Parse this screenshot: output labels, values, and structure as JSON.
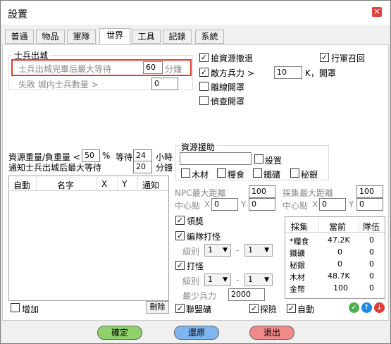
{
  "title": "設置",
  "tabs": [
    "普通",
    "物品",
    "軍隊",
    "世界",
    "工具",
    "記錄",
    "系統"
  ],
  "soldiers": {
    "group_title": "士兵出城",
    "wait_label": "士兵出城完畢后最大等待",
    "wait_value": "60",
    "wait_unit": "分鐘",
    "fail_label": "失敗 城内士兵數量 >",
    "fail_value": "0"
  },
  "right_top": {
    "grab_resource": "搶資源撤退",
    "march_recall": "行軍召回",
    "enemy_label": "敵方兵力 >",
    "enemy_value": "10",
    "enemy_unit": "K，開罩",
    "leave_shield": "離線開罩",
    "scout_shield": "偵查開罩"
  },
  "resource_weight": {
    "label": "資源重量/負重量 <",
    "value": "50",
    "percent": "%",
    "wait_label": "等待",
    "wait_value": "24",
    "wait_unit": "小時",
    "notify_label": "通知士兵出城后最大等待",
    "notify_value": "20",
    "notify_unit": "分鐘"
  },
  "aid": {
    "title": "資源援助",
    "input_value": "",
    "settings": "設置",
    "items": [
      "木材",
      "糧食",
      "鐵礦",
      "秘銀"
    ]
  },
  "auto_table": {
    "headers": [
      "自動",
      "名字",
      "X",
      "Y",
      "通知"
    ],
    "add": "增加",
    "delete": "刪除"
  },
  "npc": {
    "max_dist_label": "NPC最大距離",
    "max_dist_value": "100",
    "center_label": "中心點",
    "x_label": "X",
    "x_value": "0",
    "y_label": "Y",
    "y_value": "0"
  },
  "gather": {
    "max_dist_label": "採集最大距離",
    "max_dist_value": "100",
    "center_label": "中心點",
    "x_label": "X",
    "x_value": "0",
    "y_label": "Y",
    "y_value": "0"
  },
  "reward": "領獎",
  "team_monster": {
    "label": "編隊打怪",
    "level_label": "級別",
    "from": "1",
    "dash": "-",
    "to": "1"
  },
  "monster": {
    "label": "打怪",
    "level_label": "級別",
    "from": "1",
    "dash": "-",
    "to": "1",
    "min_label": "最少兵力",
    "min_value": "2000"
  },
  "gather_table": {
    "headers": [
      "採集",
      "當前",
      "隊伍"
    ],
    "rows": [
      {
        "name": "*糧食",
        "current": "47.2K",
        "team": "0"
      },
      {
        "name": "鐵礦",
        "current": "0",
        "team": "0"
      },
      {
        "name": "秘銀",
        "current": "0",
        "team": "0"
      },
      {
        "name": "木材",
        "current": "48.7K",
        "team": "0"
      },
      {
        "name": "金幣",
        "current": "100",
        "team": "0"
      }
    ]
  },
  "bottom_checks": {
    "league_mine": "聯盟礦",
    "explore": "探險",
    "auto": "自動"
  },
  "buttons": {
    "ok": "確定",
    "restore": "還原",
    "exit": "退出"
  },
  "colors": {
    "highlight": "#e53935",
    "ok_btn": "#8fd16a",
    "restore_btn": "#7fb6ef",
    "exit_btn": "#f08a8a"
  }
}
